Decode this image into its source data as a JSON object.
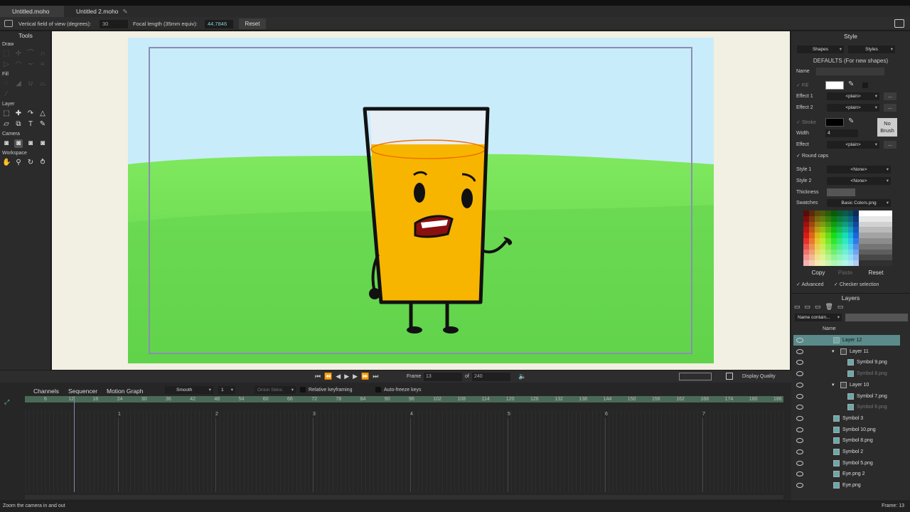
{
  "tabs": [
    {
      "label": "Untitled.moho"
    },
    {
      "label": "Untitled 2.moho"
    }
  ],
  "options": {
    "vfov_label": "Vertical field of view (degrees):",
    "vfov_value": "30",
    "focal_label": "Focal length (35mm equiv):",
    "focal_value": "44.7846",
    "reset": "Reset"
  },
  "tools": {
    "title": "Tools",
    "sections": {
      "draw": "Draw",
      "fill": "Fill",
      "layer": "Layer",
      "camera": "Camera",
      "workspace": "Workspace"
    }
  },
  "style": {
    "title": "Style",
    "shapes": "Shapes",
    "styles": "Styles",
    "defaults": "DEFAULTS (For new shapes)",
    "name_label": "Name",
    "fill_label": "Fill",
    "effect1_label": "Effect 1",
    "effect1": "<plain>",
    "effect2_label": "Effect 2",
    "effect2": "<plain>",
    "stroke_label": "Stroke",
    "width_label": "Width",
    "width_value": "4",
    "effect_label": "Effect",
    "effect": "<plain>",
    "no_brush": "No Brush",
    "round_caps": "Round caps",
    "style1_label": "Style 1",
    "style1": "<None>",
    "style2_label": "Style 2",
    "style2": "<None>",
    "thickness_label": "Thickness",
    "swatches_label": "Swatches",
    "swatches": "Basic Colors.png",
    "copy": "Copy",
    "paste": "Paste",
    "reset": "Reset",
    "advanced": "Advanced",
    "checker": "Checker selection",
    "ellipsis": "..."
  },
  "layers": {
    "title": "Layers",
    "filter": "Name contain...",
    "col_name": "Name",
    "rows": [
      {
        "name": "Layer 12"
      },
      {
        "name": "Layer 11"
      },
      {
        "name": "Symbol 9.png"
      },
      {
        "name": "Symbol 8.png"
      },
      {
        "name": "Layer 10"
      },
      {
        "name": "Symbol 7.png"
      },
      {
        "name": "Symbol 6.png"
      },
      {
        "name": "Symbol 3"
      },
      {
        "name": "Symbol 10.png"
      },
      {
        "name": "Symbol 8.png"
      },
      {
        "name": "Symbol 2"
      },
      {
        "name": "Symbol 5.png"
      },
      {
        "name": "Eye.png 2"
      },
      {
        "name": "Eye.png"
      }
    ]
  },
  "playback": {
    "frame_label": "Frame",
    "frame": "13",
    "of_label": "of",
    "total": "240",
    "display_quality": "Display Quality"
  },
  "timeline": {
    "tabs": [
      "Channels",
      "Sequencer",
      "Motion Graph"
    ],
    "interp": "Smooth",
    "interp_count": "1",
    "onion": "Onion Skins",
    "relative": "Relative keyframing",
    "autofreeze": "Auto-freeze keys",
    "frames": [
      "6",
      "12",
      "18",
      "24",
      "30",
      "36",
      "42",
      "48",
      "54",
      "60",
      "66",
      "72",
      "78",
      "84",
      "90",
      "96",
      "102",
      "108",
      "114",
      "120",
      "126",
      "132",
      "138",
      "144",
      "150",
      "156",
      "162",
      "168",
      "174",
      "180",
      "186"
    ],
    "seconds": [
      "1",
      "2",
      "3",
      "4",
      "5",
      "6",
      "7"
    ]
  },
  "status": {
    "hint": "Zoom the camera in and out",
    "frame": "Frame: 13"
  },
  "colors": {
    "sky": "#c9ecfb",
    "grass": "#6fe055",
    "juice": "#f7b500",
    "accent": "#5a8a8a"
  }
}
